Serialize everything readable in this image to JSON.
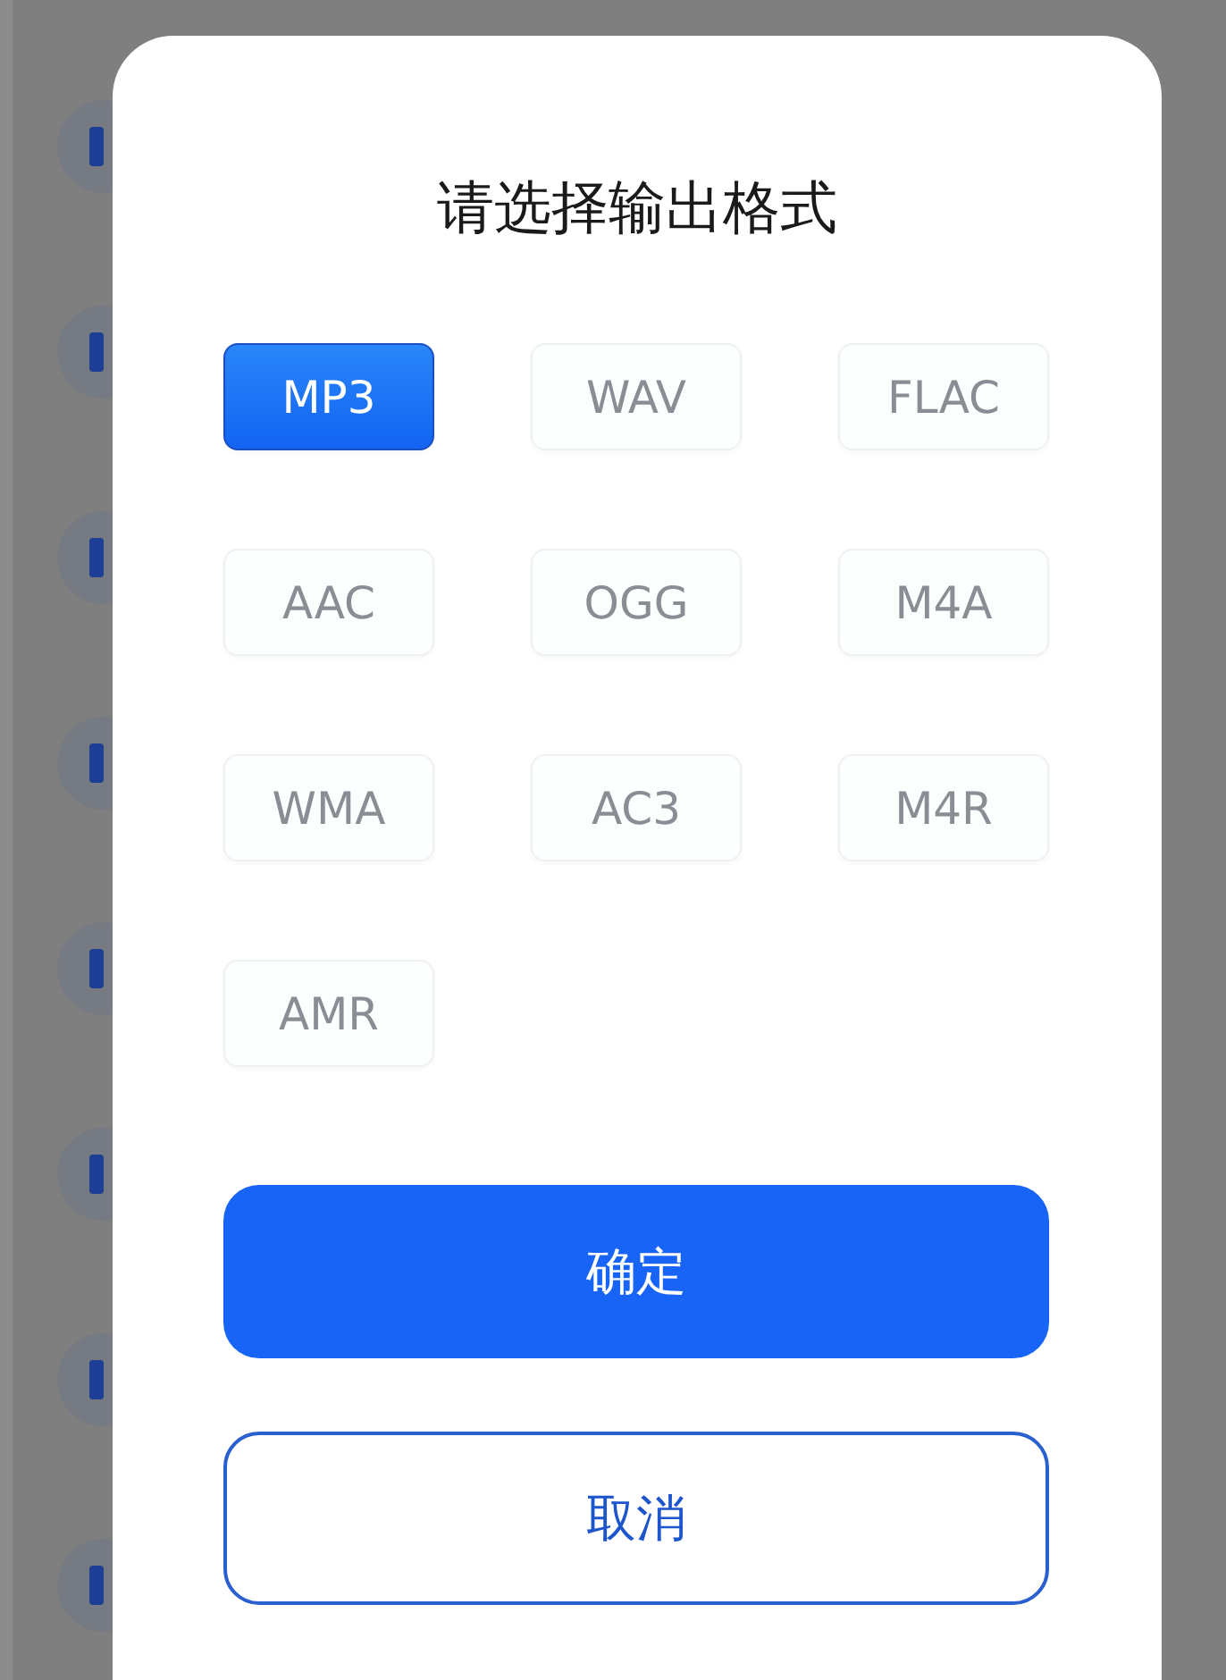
{
  "dialog": {
    "title": "请选择输出格式",
    "formats": [
      {
        "label": "MP3",
        "selected": true
      },
      {
        "label": "WAV",
        "selected": false
      },
      {
        "label": "FLAC",
        "selected": false
      },
      {
        "label": "AAC",
        "selected": false
      },
      {
        "label": "OGG",
        "selected": false
      },
      {
        "label": "M4A",
        "selected": false
      },
      {
        "label": "WMA",
        "selected": false
      },
      {
        "label": "AC3",
        "selected": false
      },
      {
        "label": "M4R",
        "selected": false
      },
      {
        "label": "AMR",
        "selected": false
      }
    ],
    "confirm_button": "确定",
    "cancel_button": "取消"
  }
}
